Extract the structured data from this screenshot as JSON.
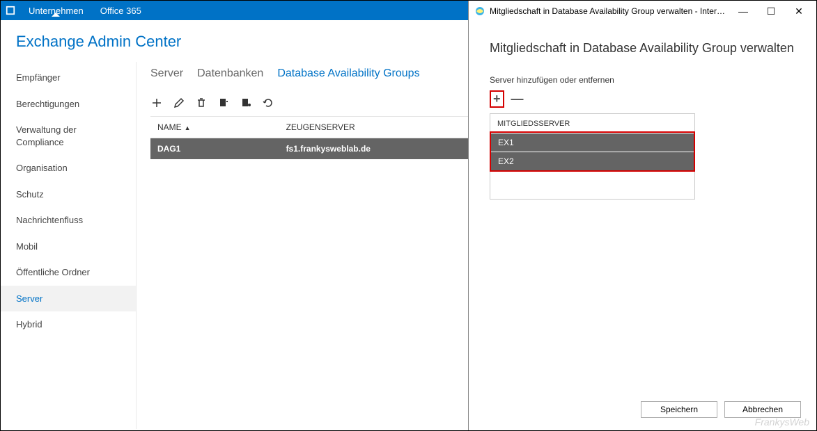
{
  "topbar": {
    "enterprise": "Unternehmen",
    "office": "Office 365"
  },
  "header": {
    "title": "Exchange Admin Center"
  },
  "sidebar": {
    "items": [
      {
        "label": "Empfänger"
      },
      {
        "label": "Berechtigungen"
      },
      {
        "label": "Verwaltung der Compliance"
      },
      {
        "label": "Organisation"
      },
      {
        "label": "Schutz"
      },
      {
        "label": "Nachrichtenfluss"
      },
      {
        "label": "Mobil"
      },
      {
        "label": "Öffentliche Ordner"
      },
      {
        "label": "Server"
      },
      {
        "label": "Hybrid"
      }
    ],
    "selected_index": 8
  },
  "tabs": {
    "items": [
      "Server",
      "Datenbanken",
      "Database Availability Groups"
    ],
    "selected_index": 2
  },
  "table": {
    "columns": [
      "NAME",
      "ZEUGENSERVER",
      "MITGLIEDSSERVER"
    ],
    "rows": [
      {
        "name": "DAG1",
        "witness": "fs1.frankysweblab.de",
        "members": ""
      }
    ]
  },
  "dialog": {
    "window_title": "Mitgliedschaft in Database Availability Group verwalten - Intern...",
    "heading": "Mitgliedschaft in Database Availability Group verwalten",
    "sub": "Server hinzufügen oder entfernen",
    "members_header": "MITGLIEDSSERVER",
    "members": [
      "EX1",
      "EX2"
    ],
    "save": "Speichern",
    "cancel": "Abbrechen"
  },
  "watermark": "FrankysWeb"
}
